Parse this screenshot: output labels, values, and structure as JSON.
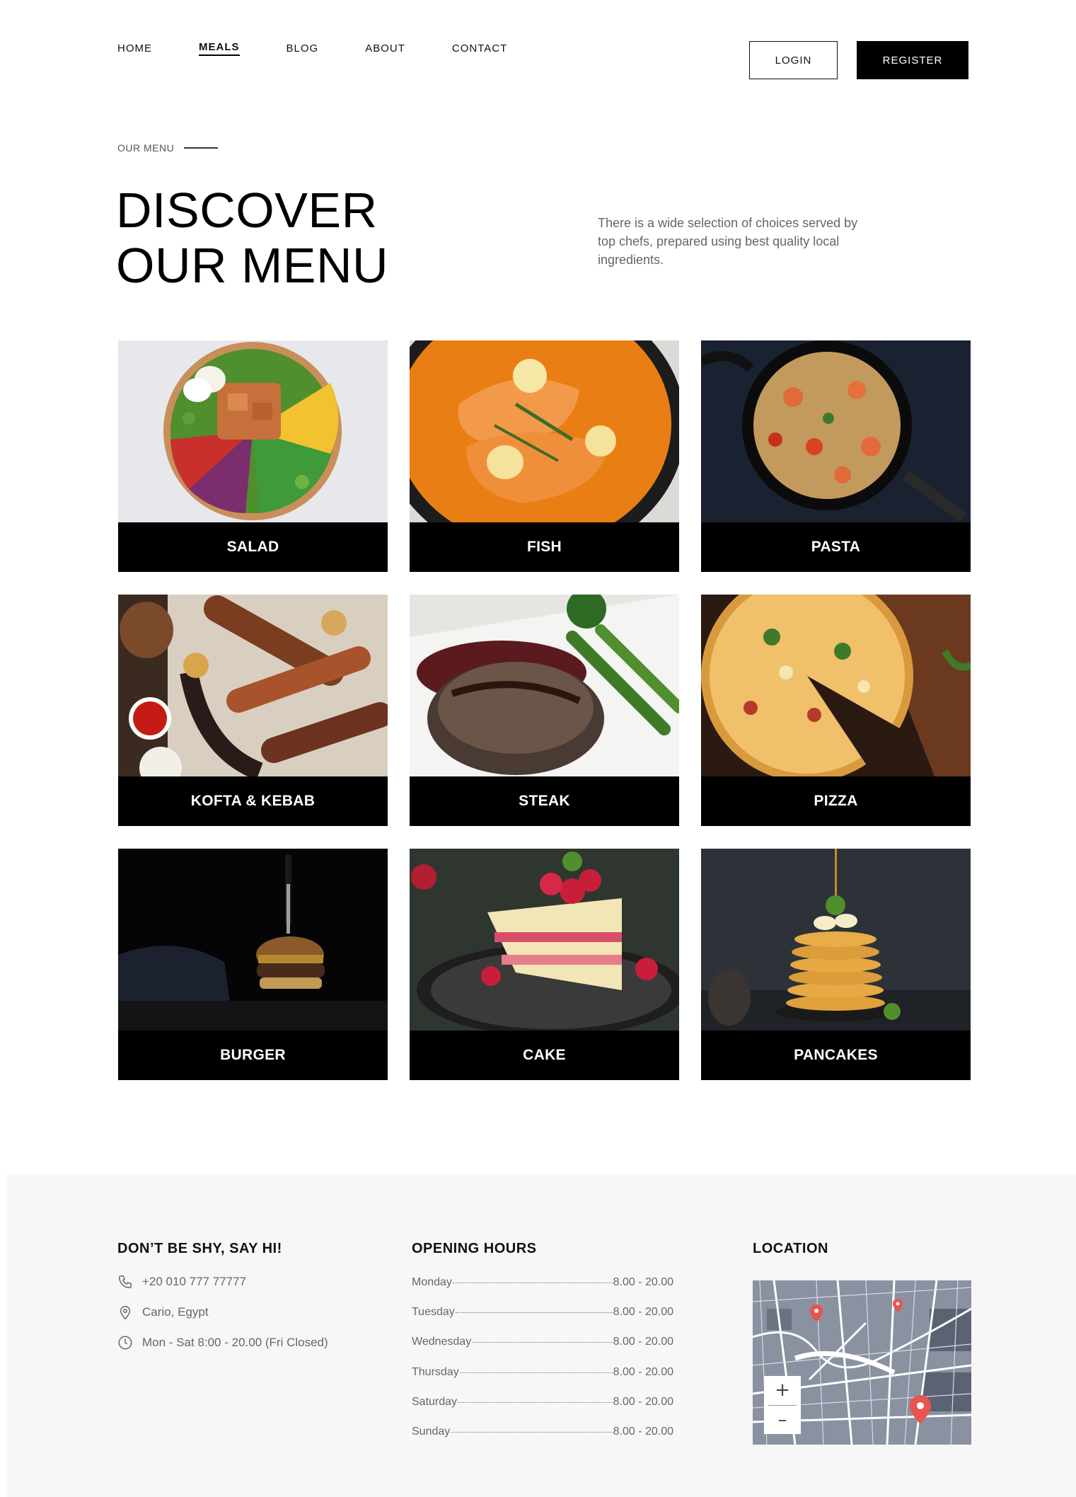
{
  "nav": {
    "items": [
      {
        "label": "HOME",
        "active": false
      },
      {
        "label": "MEALS",
        "active": true
      },
      {
        "label": "BLOG",
        "active": false
      },
      {
        "label": "ABOUT",
        "active": false
      },
      {
        "label": "CONTACT",
        "active": false
      }
    ],
    "login_label": "LOGIN",
    "register_label": "REGISTER"
  },
  "hero": {
    "eyebrow": "OUR MENU",
    "title_line1": "DISCOVER",
    "title_line2": "OUR MENU",
    "description": "There is a wide selection of choices served by top chefs, prepared using best quality local ingredients."
  },
  "menu": {
    "items": [
      {
        "label": "SALAD",
        "icon": "salad-bowl-photo"
      },
      {
        "label": "FISH",
        "icon": "salmon-pan-photo"
      },
      {
        "label": "PASTA",
        "icon": "shrimp-pasta-photo"
      },
      {
        "label": "KOFTA & KEBAB",
        "icon": "grill-platter-photo"
      },
      {
        "label": "STEAK",
        "icon": "steak-photo"
      },
      {
        "label": "PIZZA",
        "icon": "pizza-photo"
      },
      {
        "label": "BURGER",
        "icon": "burger-photo"
      },
      {
        "label": "CAKE",
        "icon": "cake-slice-photo"
      },
      {
        "label": "PANCAKES",
        "icon": "pancake-stack-photo"
      }
    ]
  },
  "footer": {
    "contact": {
      "heading": "DON’T BE SHY, SAY HI!",
      "phone": "+20 010 777 77777",
      "address": "Cario, Egypt",
      "hours": "Mon - Sat 8:00 - 20.00 (Fri Closed)"
    },
    "opening": {
      "heading": "OPENING HOURS",
      "rows": [
        {
          "day": "Monday",
          "time": "8.00 - 20.00"
        },
        {
          "day": "Tuesday",
          "time": "8.00 - 20.00"
        },
        {
          "day": "Wednesday",
          "time": "8.00 - 20.00"
        },
        {
          "day": "Thursday",
          "time": "8.00 - 20.00"
        },
        {
          "day": "Saturday",
          "time": "8.00 - 20.00"
        },
        {
          "day": "Sunday",
          "time": "8.00 - 20.00"
        }
      ]
    },
    "location": {
      "heading": "LOCATION",
      "zoom_in": "+",
      "zoom_out": "–"
    }
  },
  "colors": {
    "accent": "#000000",
    "footer_bg": "#f7f7f7",
    "muted_text": "#666666",
    "map_pin": "#e8554e"
  }
}
